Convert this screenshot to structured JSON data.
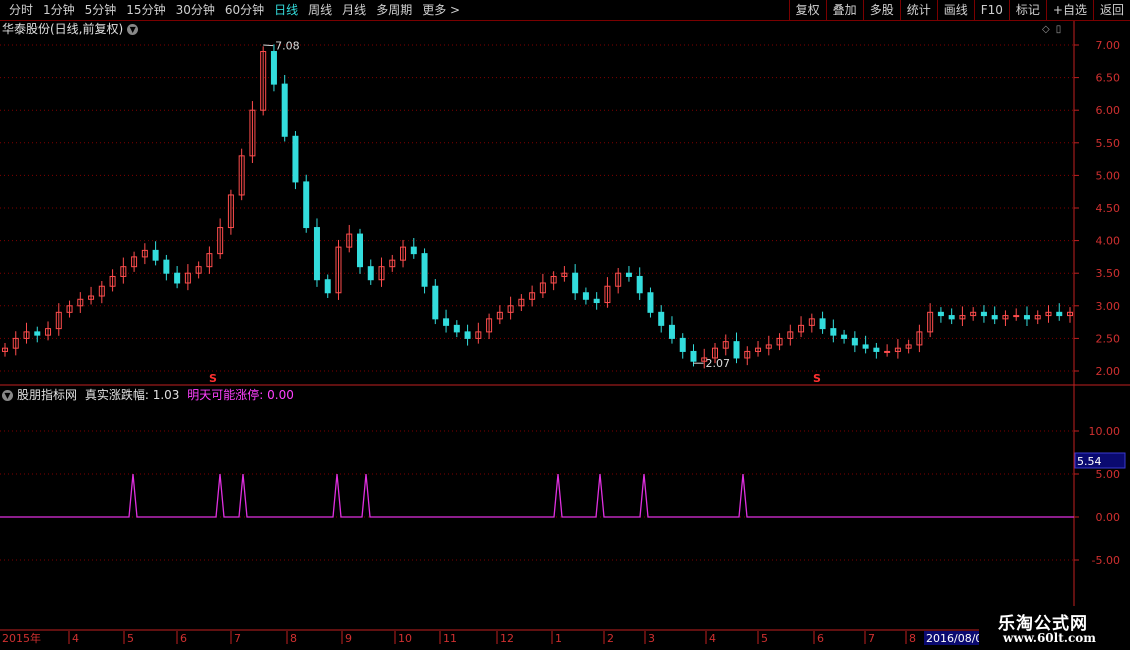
{
  "toolbar": {
    "periods": [
      "分时",
      "1分钟",
      "5分钟",
      "15分钟",
      "30分钟",
      "60分钟",
      "日线",
      "周线",
      "月线",
      "多周期",
      "更多 >"
    ],
    "active_period": "日线",
    "tools": [
      "复权",
      "叠加",
      "多股",
      "统计",
      "画线",
      "F10",
      "标记",
      "+自选",
      "返回"
    ]
  },
  "stock": {
    "title": "华泰股份(日线,前复权)"
  },
  "price_axis": {
    "labels": [
      "7.00",
      "6.50",
      "6.00",
      "5.50",
      "5.00",
      "4.50",
      "4.00",
      "3.50",
      "3.00",
      "2.50",
      "2.00"
    ]
  },
  "annotations": {
    "high": "7.08",
    "low": "2.07",
    "signal_mark": "S"
  },
  "indicator": {
    "source": "股朋指标网",
    "label1": "真实涨跌幅:",
    "value1": "1.03",
    "label2": "明天可能涨停:",
    "value2": "0.00",
    "axis_labels": [
      "10.00",
      "5.00",
      "0.00",
      "-5.00"
    ],
    "current_value": "5.54"
  },
  "time_axis": {
    "labels": [
      "2015年",
      "4",
      "5",
      "6",
      "7",
      "8",
      "9",
      "10",
      "11",
      "12",
      "1",
      "2",
      "3",
      "4",
      "5",
      "6",
      "7",
      "8"
    ],
    "current_date": "2016/08/0"
  },
  "watermark": {
    "line1": "乐淘公式网",
    "line2": "www.60lt.com"
  },
  "colors": {
    "up": "#ff4d4d",
    "down": "#33dddd",
    "grid": "#800000",
    "axis": "#c02020",
    "indicator": "#e030e0"
  },
  "chart_data": {
    "type": "candlestick",
    "y_range": [
      2.0,
      7.0
    ],
    "series": [
      {
        "name": "close",
        "values": [
          2.35,
          2.5,
          2.6,
          2.55,
          2.65,
          2.9,
          3.0,
          3.1,
          3.15,
          3.3,
          3.45,
          3.6,
          3.75,
          3.85,
          3.7,
          3.5,
          3.35,
          3.5,
          3.6,
          3.8,
          4.2,
          4.7,
          5.3,
          6.0,
          6.9,
          6.4,
          5.6,
          4.9,
          4.2,
          3.4,
          3.2,
          3.9,
          4.1,
          3.6,
          3.4,
          3.6,
          3.7,
          3.9,
          3.8,
          3.3,
          2.8,
          2.7,
          2.6,
          2.5,
          2.6,
          2.8,
          2.9,
          3.0,
          3.1,
          3.2,
          3.35,
          3.45,
          3.5,
          3.2,
          3.1,
          3.05,
          3.3,
          3.5,
          3.45,
          3.2,
          2.9,
          2.7,
          2.5,
          2.3,
          2.15,
          2.2,
          2.35,
          2.45,
          2.2,
          2.3,
          2.35,
          2.4,
          2.5,
          2.6,
          2.7,
          2.8,
          2.65,
          2.55,
          2.5,
          2.4,
          2.35,
          2.3,
          2.3,
          2.35,
          2.4,
          2.6,
          2.9,
          2.85,
          2.8,
          2.85,
          2.9,
          2.85,
          2.8,
          2.85,
          2.85,
          2.8,
          2.85,
          2.9,
          2.85,
          2.9
        ]
      },
      {
        "name": "真实涨跌幅 spikes",
        "values": [
          5.0,
          5.0,
          5.0,
          5.0,
          5.0,
          5.0,
          5.0,
          5.0,
          5.0
        ]
      }
    ],
    "spike_dates_index": [
      133,
      220,
      243,
      337,
      366,
      558,
      600,
      644,
      743
    ]
  }
}
